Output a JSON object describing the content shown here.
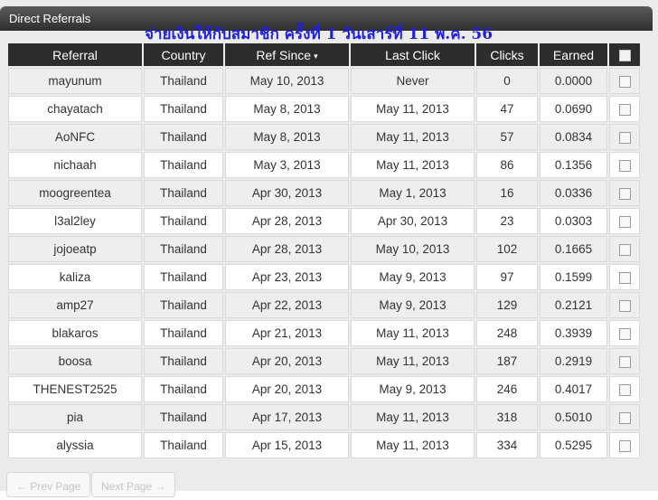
{
  "panel": {
    "title": "Direct Referrals",
    "announcement": "จ่ายเงินให้กับสมาชิก ครั้งที่ 1 วันเสาร์ที่ 11 พ.ค. 56"
  },
  "table": {
    "headers": {
      "referral": "Referral",
      "country": "Country",
      "ref_since": "Ref Since",
      "ref_since_sort": "▾",
      "last_click": "Last Click",
      "clicks": "Clicks",
      "earned": "Earned"
    },
    "rows": [
      {
        "referral": "mayunum",
        "country": "Thailand",
        "ref_since": "May 10, 2013",
        "last_click": "Never",
        "clicks": "0",
        "earned": "0.0000"
      },
      {
        "referral": "chayatach",
        "country": "Thailand",
        "ref_since": "May 8, 2013",
        "last_click": "May 11, 2013",
        "clicks": "47",
        "earned": "0.0690"
      },
      {
        "referral": "AoNFC",
        "country": "Thailand",
        "ref_since": "May 8, 2013",
        "last_click": "May 11, 2013",
        "clicks": "57",
        "earned": "0.0834"
      },
      {
        "referral": "nichaah",
        "country": "Thailand",
        "ref_since": "May 3, 2013",
        "last_click": "May 11, 2013",
        "clicks": "86",
        "earned": "0.1356"
      },
      {
        "referral": "moogreentea",
        "country": "Thailand",
        "ref_since": "Apr 30, 2013",
        "last_click": "May 1, 2013",
        "clicks": "16",
        "earned": "0.0336"
      },
      {
        "referral": "l3al2ley",
        "country": "Thailand",
        "ref_since": "Apr 28, 2013",
        "last_click": "Apr 30, 2013",
        "clicks": "23",
        "earned": "0.0303"
      },
      {
        "referral": "jojoeatp",
        "country": "Thailand",
        "ref_since": "Apr 28, 2013",
        "last_click": "May 10, 2013",
        "clicks": "102",
        "earned": "0.1665"
      },
      {
        "referral": "kaliza",
        "country": "Thailand",
        "ref_since": "Apr 23, 2013",
        "last_click": "May 9, 2013",
        "clicks": "97",
        "earned": "0.1599"
      },
      {
        "referral": "amp27",
        "country": "Thailand",
        "ref_since": "Apr 22, 2013",
        "last_click": "May 9, 2013",
        "clicks": "129",
        "earned": "0.2121"
      },
      {
        "referral": "blakaros",
        "country": "Thailand",
        "ref_since": "Apr 21, 2013",
        "last_click": "May 11, 2013",
        "clicks": "248",
        "earned": "0.3939"
      },
      {
        "referral": "boosa",
        "country": "Thailand",
        "ref_since": "Apr 20, 2013",
        "last_click": "May 11, 2013",
        "clicks": "187",
        "earned": "0.2919"
      },
      {
        "referral": "THENEST2525",
        "country": "Thailand",
        "ref_since": "Apr 20, 2013",
        "last_click": "May 9, 2013",
        "clicks": "246",
        "earned": "0.4017"
      },
      {
        "referral": "pia",
        "country": "Thailand",
        "ref_since": "Apr 17, 2013",
        "last_click": "May 11, 2013",
        "clicks": "318",
        "earned": "0.5010"
      },
      {
        "referral": "alyssia",
        "country": "Thailand",
        "ref_since": "Apr 15, 2013",
        "last_click": "May 11, 2013",
        "clicks": "334",
        "earned": "0.5295"
      }
    ]
  },
  "pagination": {
    "prev_label": "← Prev Page",
    "next_label": "Next Page →"
  },
  "colors": {
    "header_bg": "#2d2d2d",
    "announcement": "#1f1fe0",
    "row_odd": "#eeeeee",
    "row_even": "#ffffff"
  }
}
